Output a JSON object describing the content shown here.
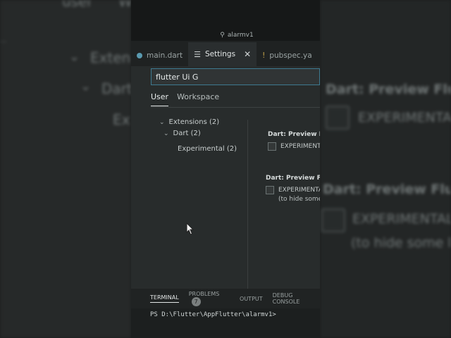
{
  "window": {
    "title": "alarmv1"
  },
  "editor_tabs": [
    {
      "label": "main.dart"
    },
    {
      "label": "Settings"
    },
    {
      "label": "pubspec.ya"
    }
  ],
  "settings": {
    "search_value": "flutter Ui G",
    "scope_tabs": [
      "User",
      "Workspace"
    ],
    "tree": {
      "extensions": "Extensions (2)",
      "dart": "Dart (2)",
      "experimental": "Experimental (2)"
    },
    "items": [
      {
        "title": "Dart: Preview Flut",
        "checkbox_label": "EXPERIMENTA"
      },
      {
        "title": "Dart: Preview Flutt",
        "checkbox_label": "EXPERIMENTAL",
        "description": "(to hide some l"
      }
    ]
  },
  "panel": {
    "tabs": [
      "TERMINAL",
      "PROBLEMS",
      "OUTPUT",
      "DEBUG CONSOLE"
    ],
    "problems_count": "7",
    "terminal_line": "PS D:\\Flutter\\AppFlutter\\alarmv1>"
  },
  "background_left": {
    "top": "user",
    "top2": "W",
    "ext": "Extens",
    "dart": "Dart",
    "ex": "Ex"
  },
  "background_right": {
    "title1": "Dart: Preview Flut",
    "chk1": "EXPERIMENTAL",
    "title2": "Dart: Preview Flutt",
    "chk2": "EXPERIMENTAL",
    "desc2": "(to hide some l"
  }
}
